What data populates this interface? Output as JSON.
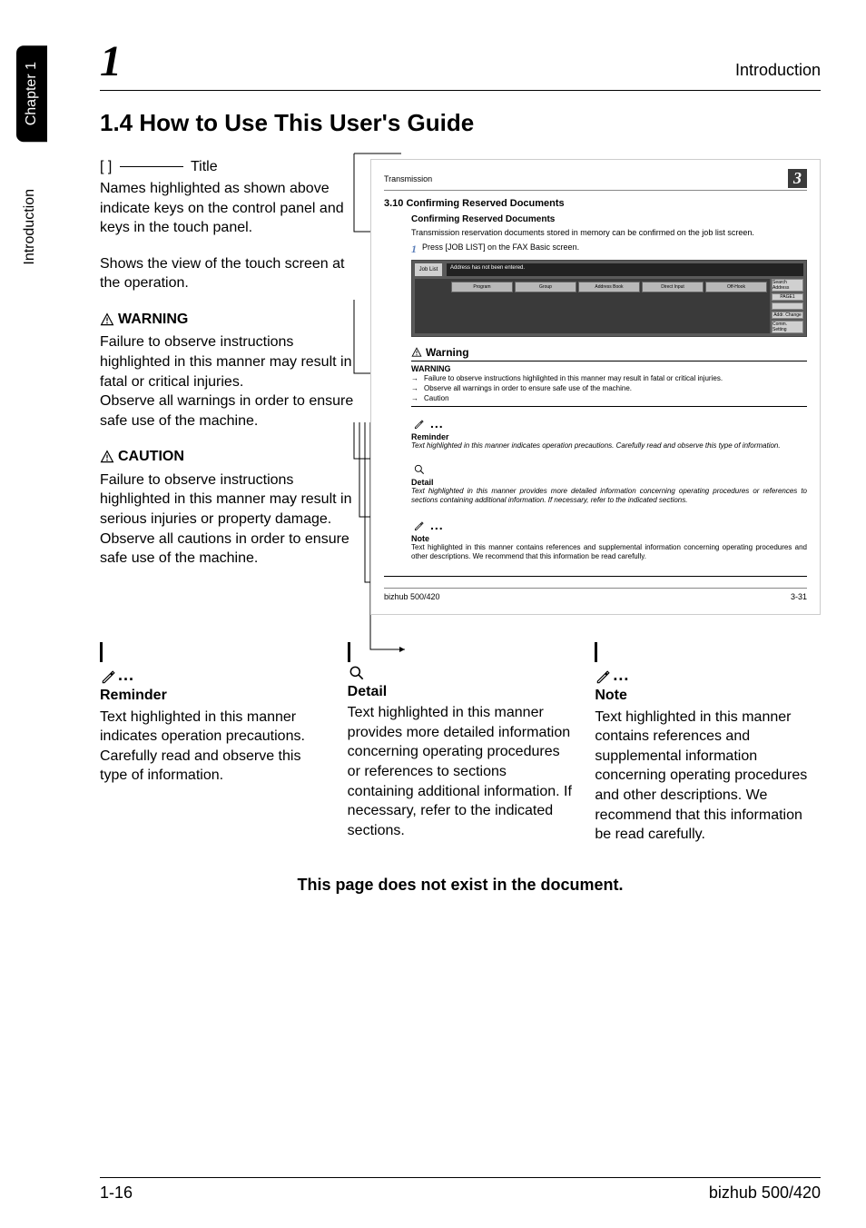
{
  "side_tab_black": "Chapter 1",
  "side_tab_white": "Introduction",
  "big_one": "1",
  "header_title": "Introduction",
  "section_title": "1.4     How to Use This User's Guide",
  "title_label": "Title",
  "brackets": "[          ]",
  "exp": {
    "names": "Names highlighted as shown above indicate keys on the control panel and keys in the touch panel.",
    "shows": "Shows the view of the touch screen at the operation.",
    "warn_head": "WARNING",
    "warn_body": "Failure to observe instructions highlighted in this manner may result in fatal or critical injuries.\nObserve all warnings in order to ensure safe use of the machine.",
    "caution_head": "CAUTION",
    "caution_body": "Failure to observe instructions highlighted in this manner may result in serious injuries or property damage.\nObserve all cautions in order to ensure safe use of the machine."
  },
  "mock": {
    "hdr_left": "Transmission",
    "hdr_num": "3",
    "sec_title": "3.10    Confirming Reserved Documents",
    "sub_title": "Confirming Reserved Documents",
    "body1": "Transmission reservation documents stored in memory can be confirmed on the job list screen.",
    "step_num": "1",
    "step_text": "Press [JOB LIST] on the FAX Basic screen.",
    "screen": {
      "tab": "Job List",
      "bar": "Address has not been entered.",
      "row": [
        "Program",
        "Group",
        "Address Book",
        "Direct Input",
        "Off-Hook"
      ],
      "side": [
        "Search Address",
        "PAGE1",
        "",
        "Addr. Change",
        "Comm. Setting"
      ]
    },
    "warn_head": "Warning",
    "warn_sub": "WARNING",
    "warn_b1": "Failure to observe instructions highlighted in this manner may result in fatal or critical injuries.",
    "warn_b2": "Observe all warnings in order to ensure safe use of the machine.",
    "warn_b3": "Caution",
    "rem_label": "Reminder",
    "rem_body": "Text highlighted in this manner indicates operation precautions. Carefully read and observe this type of information.",
    "det_label": "Detail",
    "det_body": "Text highlighted in this manner provides more detailed information concerning operating procedures or references to sections containing additional information. If necessary, refer to the indicated sections.",
    "note_label": "Note",
    "note_body": "Text highlighted in this manner contains references and supplemental information concerning operating procedures and other descriptions. We recommend that this information be read carefully.",
    "footer_left": "bizhub 500/420",
    "footer_right": "3-31"
  },
  "bottom": {
    "rem_head": "Reminder",
    "rem_body": "Text highlighted in this manner indicates operation precautions. Carefully read and observe this type of information.",
    "det_head": "Detail",
    "det_body": "Text highlighted in this manner provides more detailed information concerning operating procedures or references to sections containing additional information. If necessary, refer to the indicated sections.",
    "note_head": "Note",
    "note_body": "Text highlighted in this manner contains references and supplemental information concerning operating procedures and other descriptions. We recommend that this information be read carefully."
  },
  "nonexist": "This page does not exist in the document.",
  "footer": {
    "left": "1-16",
    "right": "bizhub 500/420"
  },
  "dots": "..."
}
